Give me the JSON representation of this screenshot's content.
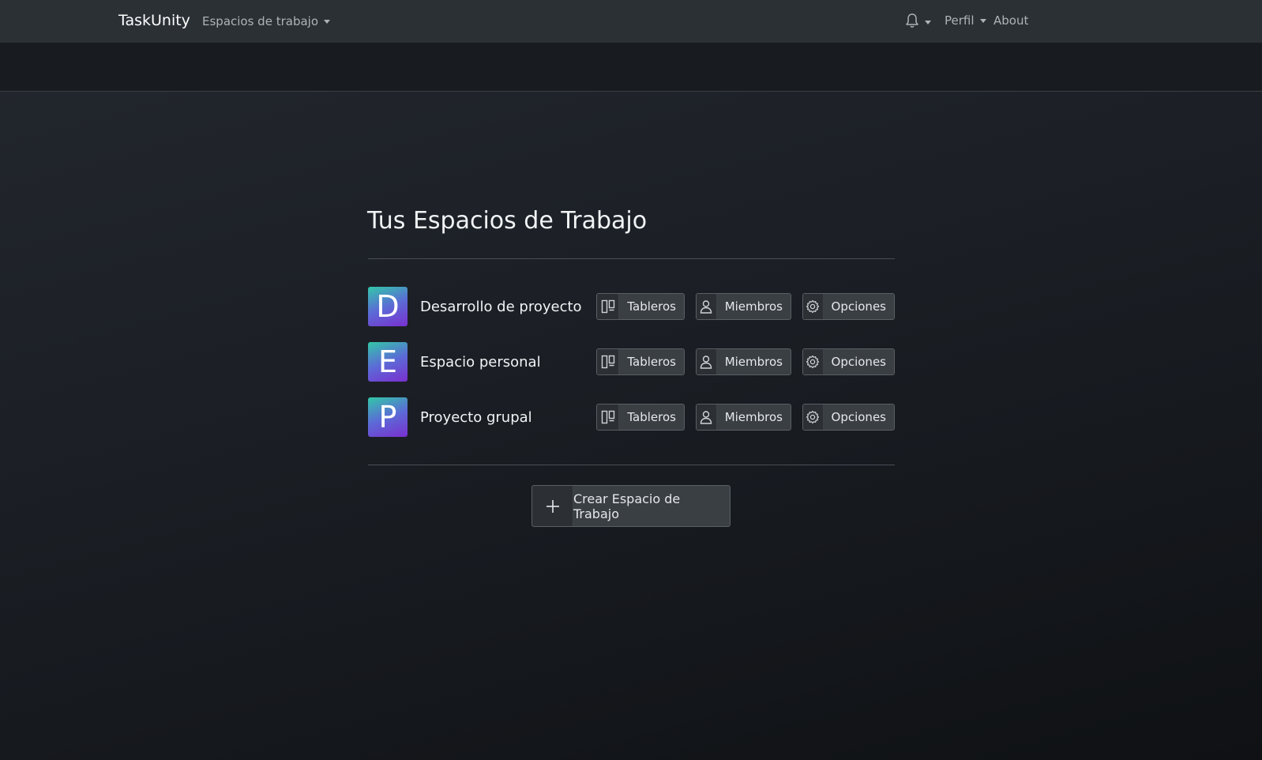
{
  "navbar": {
    "brand": "TaskUnity",
    "workspaces_menu": "Espacios de trabajo",
    "profile_menu": "Perfil",
    "about_link": "About",
    "notifications_icon": "bell-icon"
  },
  "main": {
    "title": "Tus Espacios de Trabajo",
    "workspaces": [
      {
        "initial": "D",
        "name": "Desarrollo de proyecto",
        "boards_label": "Tableros",
        "members_label": "Miembros",
        "options_label": "Opciones"
      },
      {
        "initial": "E",
        "name": "Espacio personal",
        "boards_label": "Tableros",
        "members_label": "Miembros",
        "options_label": "Opciones"
      },
      {
        "initial": "P",
        "name": "Proyecto grupal",
        "boards_label": "Tableros",
        "members_label": "Miembros",
        "options_label": "Opciones"
      }
    ],
    "create_label": "Crear Espacio de Trabajo"
  },
  "icons": {
    "boards": "board-icon",
    "members": "person-icon",
    "options": "gear-icon",
    "create": "plus-icon"
  },
  "colors": {
    "navbar_bg": "#2b3035",
    "avatar_gradient_start": "#32c8a8",
    "avatar_gradient_end": "#7a2fd0"
  }
}
